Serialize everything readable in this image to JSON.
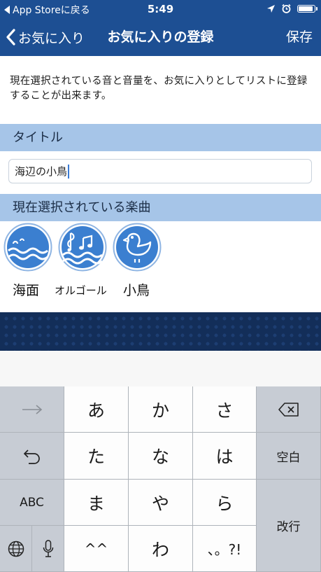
{
  "status_bar": {
    "back_label": "App Storeに戻る",
    "time": "5:49",
    "battery_level": 1.0
  },
  "nav": {
    "back_label": "お気に入り",
    "title": "お気に入りの登録",
    "save_label": "保存"
  },
  "description": "現在選択されている音と音量を、お気に入りとしてリストに登録することが出来ます。",
  "title_section": {
    "header": "タイトル",
    "input_value": "海辺の小鳥"
  },
  "sounds_section": {
    "header": "現在選択されている楽曲",
    "items": [
      {
        "label": "海面",
        "icon": "sea-waves-icon"
      },
      {
        "label": "オルゴール",
        "icon": "music-box-icon"
      },
      {
        "label": "小鳥",
        "icon": "bird-icon"
      }
    ]
  },
  "keyboard": {
    "left_keys": [
      "→",
      "undo",
      "ABC",
      "globe",
      "mic"
    ],
    "kana_keys": [
      "あ",
      "か",
      "さ",
      "た",
      "な",
      "は",
      "ま",
      "や",
      "ら",
      "^^",
      "わ",
      "、。?!"
    ],
    "space_label": "空白",
    "return_label": "改行"
  },
  "colors": {
    "nav_blue": "#1d4f93",
    "section_blue": "#a6c5e8",
    "banner_navy": "#132e59",
    "icon_blue": "#3b7fd0"
  }
}
